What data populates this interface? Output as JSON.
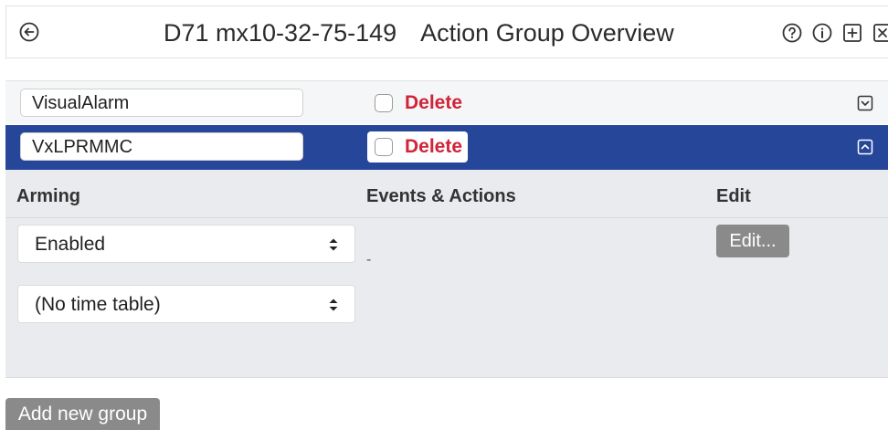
{
  "header": {
    "device": "D71 mx10-32-75-149",
    "title": "Action Group Overview",
    "icons": [
      "back-icon",
      "help-icon",
      "info-icon",
      "add-icon",
      "close-icon"
    ]
  },
  "groups": [
    {
      "name": "VisualAlarm",
      "delete_label": "Delete",
      "expanded": false
    },
    {
      "name": "VxLPRMMC",
      "delete_label": "Delete",
      "expanded": true
    }
  ],
  "panel": {
    "columns": {
      "arming": "Arming",
      "events": "Events & Actions",
      "edit": "Edit"
    },
    "arming_value": "Enabled",
    "timetable_value": "(No time table)",
    "events_value": "-",
    "edit_label": "Edit..."
  },
  "footer": {
    "add_label": "Add new group"
  },
  "colors": {
    "selected_row": "#26469a",
    "delete_text": "#d0243a",
    "panel_bg": "#e9ebee",
    "button_gray": "#8a8a8a"
  }
}
